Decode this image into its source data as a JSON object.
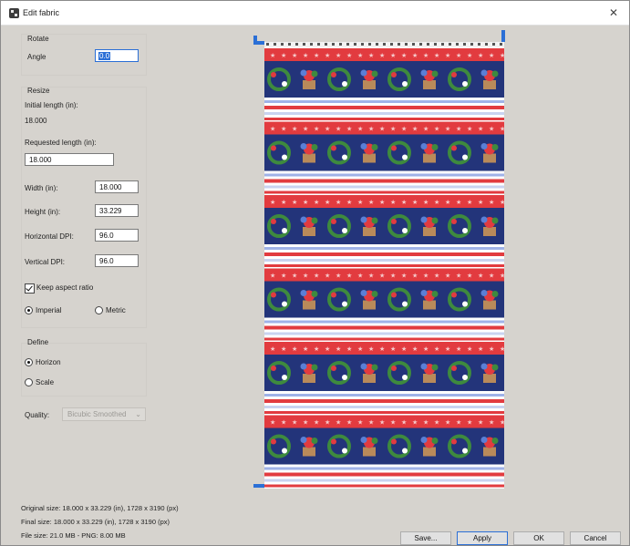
{
  "window": {
    "title": "Edit fabric"
  },
  "rotate": {
    "group_label": "Rotate",
    "angle_label": "Angle",
    "angle_value": "0.0"
  },
  "resize": {
    "group_label": "Resize",
    "initial_length_label": "Initial length (in):",
    "initial_length_value": "18.000",
    "requested_length_label": "Requested length (in):",
    "requested_length_value": "18.000",
    "width_label": "Width (in):",
    "width_value": "18.000",
    "height_label": "Height (in):",
    "height_value": "33.229",
    "hdpi_label": "Horizontal DPI:",
    "hdpi_value": "96.0",
    "vdpi_label": "Vertical DPI:",
    "vdpi_value": "96.0",
    "keep_aspect_label": "Keep aspect ratio",
    "keep_aspect_checked": true,
    "imperial_label": "Imperial",
    "metric_label": "Metric",
    "unit_selected": "Imperial"
  },
  "define": {
    "group_label": "Define",
    "horizon_label": "Horizon",
    "scale_label": "Scale",
    "selected": "Horizon"
  },
  "quality": {
    "label": "Quality:",
    "value": "Bicubic Smoothed"
  },
  "info": {
    "original_size": "Original size: 18.000 x 33.229 (in), 1728 x 3190 (px)",
    "final_size": "Final size: 18.000 x 33.229 (in), 1728 x 3190 (px)",
    "file_size": "File size: 21.0 MB - PNG: 8.00 MB"
  },
  "buttons": {
    "save": "Save...",
    "apply": "Apply",
    "ok": "OK",
    "cancel": "Cancel"
  },
  "colors": {
    "accent": "#2b6fd6",
    "fabric_red": "#e23b3f",
    "fabric_navy": "#23347a",
    "fabric_white": "#ffffff"
  }
}
